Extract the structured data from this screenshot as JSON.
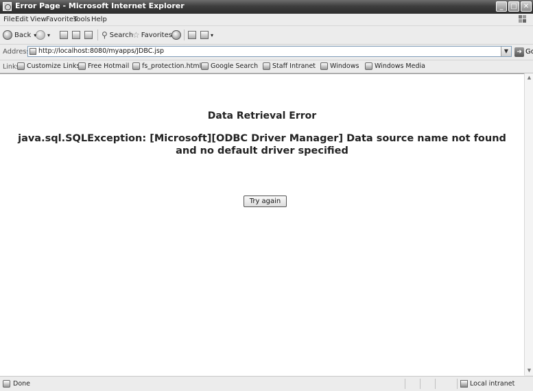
{
  "window": {
    "title": "Error Page - Microsoft Internet Explorer",
    "controls": {
      "minimize": "_",
      "maximize": "□",
      "close": "✕"
    }
  },
  "menubar": {
    "items": [
      {
        "label": "File"
      },
      {
        "label": "Edit"
      },
      {
        "label": "View"
      },
      {
        "label": "Favorites"
      },
      {
        "label": "Tools"
      },
      {
        "label": "Help"
      }
    ]
  },
  "toolbar": {
    "back_label": "Back",
    "search_label": "Search",
    "favorites_label": "Favorites"
  },
  "address": {
    "label": "Address",
    "url": "http://localhost:8080/myapps/JDBC.jsp",
    "go_label": "Go"
  },
  "links": {
    "label": "Links",
    "items": [
      {
        "label": "Customize Links"
      },
      {
        "label": "Free Hotmail"
      },
      {
        "label": "fs_protection.html"
      },
      {
        "label": "Google Search"
      },
      {
        "label": "Staff Intranet"
      },
      {
        "label": "Windows"
      },
      {
        "label": "Windows Media"
      }
    ]
  },
  "page": {
    "heading": "Data Retrieval Error",
    "message": "java.sql.SQLException: [Microsoft][ODBC Driver Manager] Data source name not found and no default driver specified",
    "button_label": "Try again"
  },
  "status": {
    "text": "Done",
    "zone": "Local intranet"
  }
}
